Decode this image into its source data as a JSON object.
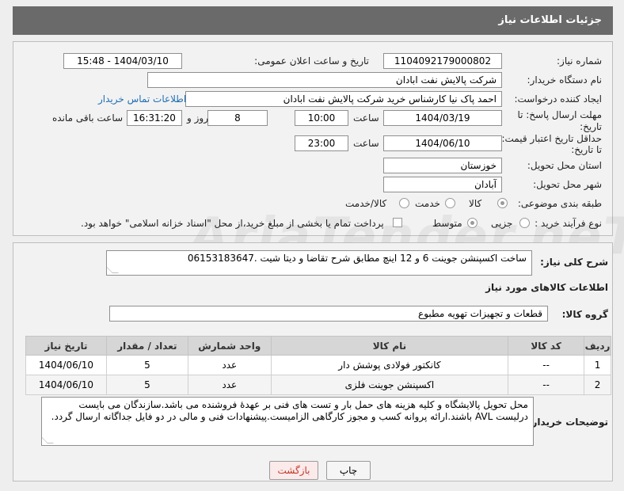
{
  "header": {
    "title": "جزئیات اطلاعات نیاز"
  },
  "form": {
    "need_number_label": "شماره نیاز:",
    "need_number": "1104092179000802",
    "announce_label": "تاریخ و ساعت اعلان عمومی:",
    "announce_value": "1404/03/10 - 15:48",
    "buyer_org_label": "نام دستگاه خریدار:",
    "buyer_org": "شرکت پالایش نفت ابادان",
    "requester_label": "ایجاد کننده درخواست:",
    "requester": "احمد پاک نیا کارشناس خرید شرکت پالایش نفت ابادان",
    "contact_link": "اطلاعات تماس خریدار",
    "deadline_label1": "مهلت ارسال پاسخ: تا",
    "deadline_label2": "تاریخ:",
    "deadline_date": "1404/03/19",
    "time_label": "ساعت",
    "deadline_time": "10:00",
    "days_value": "8",
    "days_label": "روز و",
    "remaining_time": "16:31:20",
    "remaining_label": "ساعت باقی مانده",
    "validity_label1": "حداقل تاریخ اعتبار قیمت:",
    "validity_label2": "تا تاریخ:",
    "validity_date": "1404/06/10",
    "validity_time": "23:00",
    "province_label": "استان محل تحویل:",
    "province": "خوزستان",
    "city_label": "شهر محل تحویل:",
    "city": "آبادان",
    "category_label": "طبقه بندی موضوعی:",
    "category_options": [
      "کالا",
      "خدمت",
      "کالا/خدمت"
    ],
    "process_label": "نوع فرآیند خرید :",
    "process_options": [
      "جزیی",
      "متوسط"
    ],
    "payment_note": "پرداخت تمام یا بخشی از مبلغ خرید،از محل \"اسناد خزانه اسلامی\" خواهد بود."
  },
  "summary": {
    "label": "شرح کلی نیاز:",
    "text": "ساخت اکسپنشن جوینت 6 و 12 اینچ مطابق شرح تقاضا و دیتا شیت .06153183647"
  },
  "goods": {
    "section_title": "اطلاعات کالاهای مورد نیاز",
    "group_label": "گروه کالا:",
    "group_value": "قطعات و تجهیزات تهویه مطبوع",
    "columns": [
      "ردیف",
      "کد کالا",
      "نام کالا",
      "واحد شمارش",
      "تعداد / مقدار",
      "تاریخ نیاز"
    ],
    "rows": [
      [
        "1",
        "--",
        "کانکتور فولادی پوشش دار",
        "عدد",
        "5",
        "1404/06/10"
      ],
      [
        "2",
        "--",
        "اکسپنشن جوینت فلزی",
        "عدد",
        "5",
        "1404/06/10"
      ]
    ]
  },
  "notes": {
    "label": "توضیحات خریدار:",
    "text": "محل تحویل پالایشگاه و کلیه هزینه های حمل بار و تست های فنی بر عهدۀ فروشنده می باشد.سازندگان می بایست درلیست AVL باشند.ارائه پروانه کسب و مجوز کارگاهی الزامیست.پیشنهادات فنی و مالی در دو فایل جداگانه ارسال گردد."
  },
  "buttons": {
    "print": "چاپ",
    "back": "بازگشت"
  },
  "watermark": "AriaTender.neT",
  "colors": {
    "header_bg": "#6a6a6a",
    "link": "#1f6fb5",
    "back_text": "#c0392b"
  }
}
